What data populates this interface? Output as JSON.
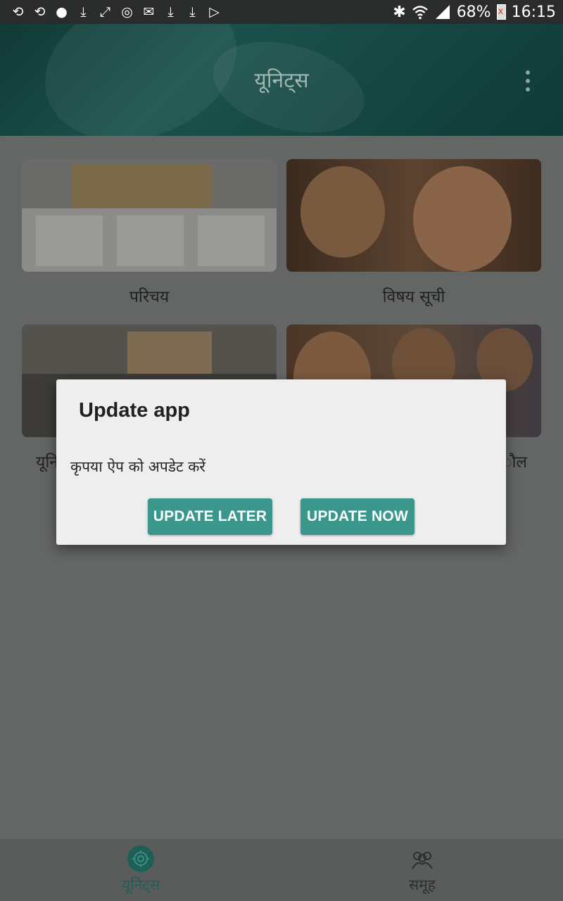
{
  "status_bar": {
    "left_icons": [
      "sync-icon",
      "sync-icon",
      "chat-icon",
      "download-icon",
      "shuffle-icon",
      "location-icon",
      "mail-icon",
      "download-icon",
      "download-icon",
      "play-store-icon"
    ],
    "battery_percent": "68%",
    "time": "16:15"
  },
  "app_bar": {
    "title": "यूनिट्स",
    "overflow": "more-options"
  },
  "cards": [
    {
      "caption": "परिचय"
    },
    {
      "caption": "विषय सूची"
    },
    {
      "caption": "यूनि"
    },
    {
      "caption": "ौल"
    }
  ],
  "dialog": {
    "title": "Update app",
    "message": "कृपया ऐप को अपडेट करें",
    "later_label": "UPDATE LATER",
    "now_label": "UPDATE NOW"
  },
  "bottom_nav": {
    "items": [
      {
        "label": "यूनिट्स",
        "icon": "units-icon",
        "active": true
      },
      {
        "label": "समूह",
        "icon": "group-icon",
        "active": false
      }
    ]
  },
  "colors": {
    "accent": "#3b978c",
    "app_bar": "#174844",
    "nav_active": "#1e5f58"
  }
}
